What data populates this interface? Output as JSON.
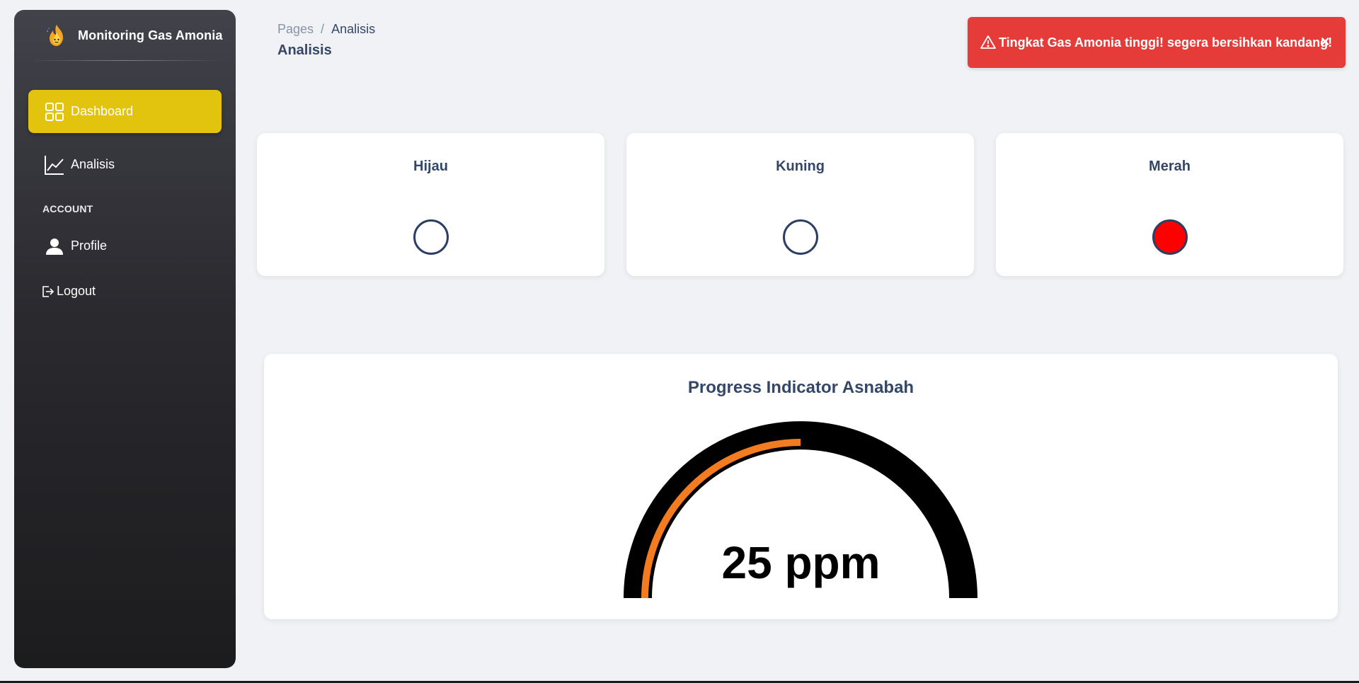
{
  "app": {
    "title": "Monitoring Gas Amonia"
  },
  "sidebar": {
    "items": [
      {
        "label": "Dashboard",
        "icon": "dashboard-grid-icon",
        "active": true
      },
      {
        "label": "Analisis",
        "icon": "line-chart-icon",
        "active": false
      }
    ],
    "section_label": "ACCOUNT",
    "account_items": [
      {
        "label": "Profile",
        "icon": "person-icon"
      },
      {
        "label": "Logout",
        "icon": "logout-icon"
      }
    ]
  },
  "header": {
    "breadcrumb_root": "Pages",
    "breadcrumb_separator": "/",
    "breadcrumb_current": "Analisis",
    "title": "Analisis"
  },
  "alert": {
    "icon": "warning-triangle-icon",
    "message": "Tingkat Gas Amonia tinggi! segera bersihkan kandang!",
    "close_label": "×",
    "color": "#e53c3a"
  },
  "indicators": [
    {
      "label": "Hijau",
      "active": false,
      "color": "#ffffff"
    },
    {
      "label": "Kuning",
      "active": false,
      "color": "#ffffff"
    },
    {
      "label": "Merah",
      "active": true,
      "color": "#ff0000"
    }
  ],
  "gauge": {
    "title": "Progress Indicator Asnabah",
    "value_text": "25 ppm",
    "progress_fraction": 0.5,
    "track_color": "#000000",
    "progress_color": "#f47c20"
  },
  "colors": {
    "active_nav": "#e2c40f",
    "lamp_border": "#2c3e63"
  }
}
